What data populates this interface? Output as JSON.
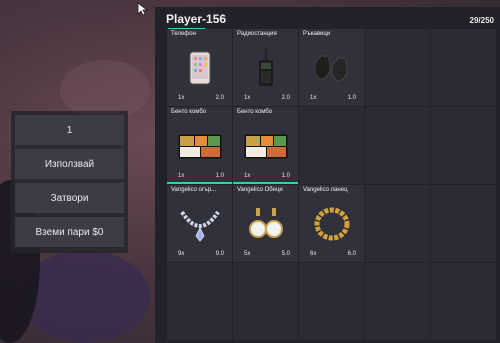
{
  "action_menu": {
    "quantity_label": "1",
    "use_label": "Използвай",
    "close_label": "Затвори",
    "take_money_label": "Вземи пари $0"
  },
  "inventory": {
    "title": "Player-156",
    "capacity": "29/250",
    "accent_color": "#2bd7a4",
    "slots": [
      {
        "name": "Телефон",
        "qty": "1x",
        "weight": "2.0",
        "icon": "phone-icon"
      },
      {
        "name": "Радиостанция",
        "qty": "1x",
        "weight": "2.0",
        "icon": "radio-icon"
      },
      {
        "name": "Ръкавици",
        "qty": "1x",
        "weight": "1.0",
        "icon": "gloves-icon"
      },
      {
        "name": "Бенто комбо",
        "qty": "1x",
        "weight": "1.0",
        "icon": "bento-icon"
      },
      {
        "name": "Бенто комбо",
        "qty": "1x",
        "weight": "1.0",
        "icon": "bento-icon"
      },
      {
        "name": "Vangelico огър...",
        "qty": "9x",
        "weight": "9.0",
        "icon": "necklace-icon"
      },
      {
        "name": "Vangelico Обеци",
        "qty": "5x",
        "weight": "5.0",
        "icon": "earrings-icon"
      },
      {
        "name": "Vangelico ланец",
        "qty": "6x",
        "weight": "6.0",
        "icon": "chain-icon"
      }
    ]
  }
}
